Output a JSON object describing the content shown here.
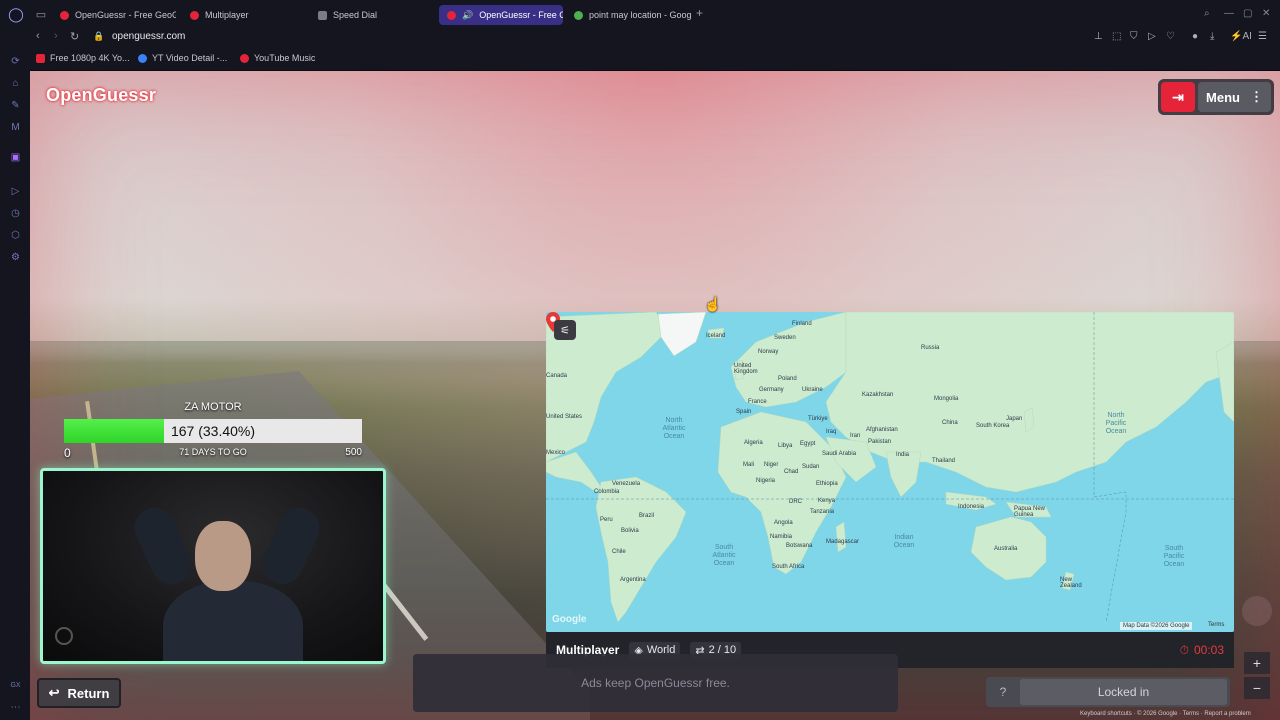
{
  "browser": {
    "tabs": [
      {
        "label": "OpenGuessr - Free GeoGu",
        "favicon_color": "#e5243a",
        "active": false
      },
      {
        "label": "Multiplayer",
        "favicon_color": "#e5243a",
        "active": false
      },
      {
        "label": "Speed Dial",
        "favicon_color": "#9a9aa8",
        "active": false
      },
      {
        "label": "OpenGuessr - Free Ge",
        "favicon_color": "#e5243a",
        "active": true
      },
      {
        "label": "point may location - Goog",
        "favicon_color": "#4caf50",
        "active": false
      }
    ],
    "url": "openguessr.com",
    "bookmarks": [
      {
        "label": "Free 1080p 4K Yo...",
        "favicon_color": "#e5243a"
      },
      {
        "label": "YT Video Detail -...",
        "favicon_color": "#3b82f6"
      },
      {
        "label": "YouTube Music",
        "favicon_color": "#e5243a"
      }
    ],
    "toolbar_ai": "AI"
  },
  "game": {
    "logo": "OpenGuessr",
    "menu_label": "Menu",
    "exit_icon": "exit-icon",
    "goal": {
      "title": "ZA MOTOR",
      "progress_text": "167 (33.40%)",
      "progress_fraction": 0.334,
      "min": "0",
      "max": "500",
      "subtitle": "71 DAYS TO GO"
    },
    "return_label": "Return",
    "map": {
      "labels": {
        "finland": "Finland",
        "iceland": "Iceland",
        "russia": "Russia",
        "sweden": "Sweden",
        "norway": "Norway",
        "united_kingdom": "United Kingdom",
        "poland": "Poland",
        "germany": "Germany",
        "ukraine": "Ukraine",
        "france": "France",
        "kazakhstan": "Kazakhstan",
        "mongolia": "Mongolia",
        "spain": "Spain",
        "turkiye": "Türkiye",
        "canada": "Canada",
        "united_states": "United States",
        "north_atlantic": "North Atlantic Ocean",
        "north_pacific": "North Pacific Ocean",
        "japan": "Japan",
        "south_korea": "South Korea",
        "china": "China",
        "afghanistan": "Afghanistan",
        "iran": "Iran",
        "iraq": "Iraq",
        "pakistan": "Pakistan",
        "algeria": "Algeria",
        "libya": "Libya",
        "egypt": "Egypt",
        "saudi_arabia": "Saudi Arabia",
        "india": "India",
        "thailand": "Thailand",
        "mexico": "Mexico",
        "mali": "Mali",
        "niger": "Niger",
        "chad": "Chad",
        "sudan": "Sudan",
        "nigeria": "Nigeria",
        "ethiopia": "Ethiopia",
        "venezuela": "Venezuela",
        "colombia": "Colombia",
        "drc": "DRC",
        "kenya": "Kenya",
        "tanzania": "Tanzania",
        "indonesia": "Indonesia",
        "papua": "Papua New Guinea",
        "peru": "Peru",
        "brazil": "Brazil",
        "angola": "Angola",
        "bolivia": "Bolivia",
        "namibia": "Namibia",
        "botswana": "Botswana",
        "madagascar": "Madagascar",
        "indian_ocean": "Indian Ocean",
        "australia": "Australia",
        "south_atlantic": "South Atlantic Ocean",
        "south_pacific": "South Pacific Ocean",
        "chile": "Chile",
        "south_africa": "South Africa",
        "argentina": "Argentina",
        "new_zealand": "New Zealand"
      },
      "google": "Google",
      "attribution": "Map Data ©2026 Google",
      "terms": "Terms"
    },
    "footer": {
      "mode": "Multiplayer",
      "region": "World",
      "round": "2 / 10",
      "timer": "00:03"
    },
    "ads_text": "Ads keep OpenGuessr free.",
    "help_label": "?",
    "locked_label": "Locked in",
    "keyboard_shortcuts": "Keyboard shortcuts  ·  © 2026 Google  ·  Terms  ·  Report a problem",
    "accent_color": "#e5243a",
    "progress_color": "#3ee038"
  }
}
